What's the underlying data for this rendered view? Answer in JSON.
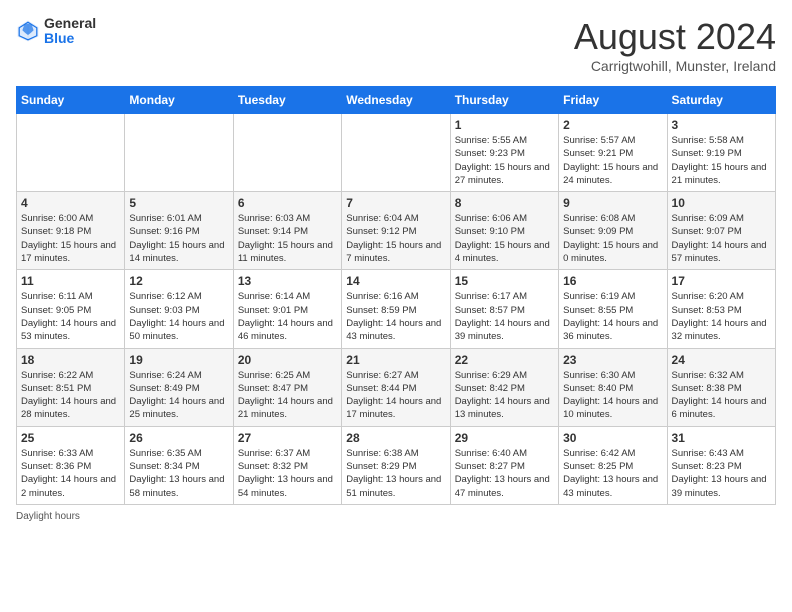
{
  "header": {
    "logo_general": "General",
    "logo_blue": "Blue",
    "month_title": "August 2024",
    "location": "Carrigtwohill, Munster, Ireland"
  },
  "weekdays": [
    "Sunday",
    "Monday",
    "Tuesday",
    "Wednesday",
    "Thursday",
    "Friday",
    "Saturday"
  ],
  "weeks": [
    [
      {
        "day": "",
        "info": ""
      },
      {
        "day": "",
        "info": ""
      },
      {
        "day": "",
        "info": ""
      },
      {
        "day": "",
        "info": ""
      },
      {
        "day": "1",
        "info": "Sunrise: 5:55 AM\nSunset: 9:23 PM\nDaylight: 15 hours and 27 minutes."
      },
      {
        "day": "2",
        "info": "Sunrise: 5:57 AM\nSunset: 9:21 PM\nDaylight: 15 hours and 24 minutes."
      },
      {
        "day": "3",
        "info": "Sunrise: 5:58 AM\nSunset: 9:19 PM\nDaylight: 15 hours and 21 minutes."
      }
    ],
    [
      {
        "day": "4",
        "info": "Sunrise: 6:00 AM\nSunset: 9:18 PM\nDaylight: 15 hours and 17 minutes."
      },
      {
        "day": "5",
        "info": "Sunrise: 6:01 AM\nSunset: 9:16 PM\nDaylight: 15 hours and 14 minutes."
      },
      {
        "day": "6",
        "info": "Sunrise: 6:03 AM\nSunset: 9:14 PM\nDaylight: 15 hours and 11 minutes."
      },
      {
        "day": "7",
        "info": "Sunrise: 6:04 AM\nSunset: 9:12 PM\nDaylight: 15 hours and 7 minutes."
      },
      {
        "day": "8",
        "info": "Sunrise: 6:06 AM\nSunset: 9:10 PM\nDaylight: 15 hours and 4 minutes."
      },
      {
        "day": "9",
        "info": "Sunrise: 6:08 AM\nSunset: 9:09 PM\nDaylight: 15 hours and 0 minutes."
      },
      {
        "day": "10",
        "info": "Sunrise: 6:09 AM\nSunset: 9:07 PM\nDaylight: 14 hours and 57 minutes."
      }
    ],
    [
      {
        "day": "11",
        "info": "Sunrise: 6:11 AM\nSunset: 9:05 PM\nDaylight: 14 hours and 53 minutes."
      },
      {
        "day": "12",
        "info": "Sunrise: 6:12 AM\nSunset: 9:03 PM\nDaylight: 14 hours and 50 minutes."
      },
      {
        "day": "13",
        "info": "Sunrise: 6:14 AM\nSunset: 9:01 PM\nDaylight: 14 hours and 46 minutes."
      },
      {
        "day": "14",
        "info": "Sunrise: 6:16 AM\nSunset: 8:59 PM\nDaylight: 14 hours and 43 minutes."
      },
      {
        "day": "15",
        "info": "Sunrise: 6:17 AM\nSunset: 8:57 PM\nDaylight: 14 hours and 39 minutes."
      },
      {
        "day": "16",
        "info": "Sunrise: 6:19 AM\nSunset: 8:55 PM\nDaylight: 14 hours and 36 minutes."
      },
      {
        "day": "17",
        "info": "Sunrise: 6:20 AM\nSunset: 8:53 PM\nDaylight: 14 hours and 32 minutes."
      }
    ],
    [
      {
        "day": "18",
        "info": "Sunrise: 6:22 AM\nSunset: 8:51 PM\nDaylight: 14 hours and 28 minutes."
      },
      {
        "day": "19",
        "info": "Sunrise: 6:24 AM\nSunset: 8:49 PM\nDaylight: 14 hours and 25 minutes."
      },
      {
        "day": "20",
        "info": "Sunrise: 6:25 AM\nSunset: 8:47 PM\nDaylight: 14 hours and 21 minutes."
      },
      {
        "day": "21",
        "info": "Sunrise: 6:27 AM\nSunset: 8:44 PM\nDaylight: 14 hours and 17 minutes."
      },
      {
        "day": "22",
        "info": "Sunrise: 6:29 AM\nSunset: 8:42 PM\nDaylight: 14 hours and 13 minutes."
      },
      {
        "day": "23",
        "info": "Sunrise: 6:30 AM\nSunset: 8:40 PM\nDaylight: 14 hours and 10 minutes."
      },
      {
        "day": "24",
        "info": "Sunrise: 6:32 AM\nSunset: 8:38 PM\nDaylight: 14 hours and 6 minutes."
      }
    ],
    [
      {
        "day": "25",
        "info": "Sunrise: 6:33 AM\nSunset: 8:36 PM\nDaylight: 14 hours and 2 minutes."
      },
      {
        "day": "26",
        "info": "Sunrise: 6:35 AM\nSunset: 8:34 PM\nDaylight: 13 hours and 58 minutes."
      },
      {
        "day": "27",
        "info": "Sunrise: 6:37 AM\nSunset: 8:32 PM\nDaylight: 13 hours and 54 minutes."
      },
      {
        "day": "28",
        "info": "Sunrise: 6:38 AM\nSunset: 8:29 PM\nDaylight: 13 hours and 51 minutes."
      },
      {
        "day": "29",
        "info": "Sunrise: 6:40 AM\nSunset: 8:27 PM\nDaylight: 13 hours and 47 minutes."
      },
      {
        "day": "30",
        "info": "Sunrise: 6:42 AM\nSunset: 8:25 PM\nDaylight: 13 hours and 43 minutes."
      },
      {
        "day": "31",
        "info": "Sunrise: 6:43 AM\nSunset: 8:23 PM\nDaylight: 13 hours and 39 minutes."
      }
    ]
  ],
  "footer": {
    "note": "Daylight hours"
  }
}
